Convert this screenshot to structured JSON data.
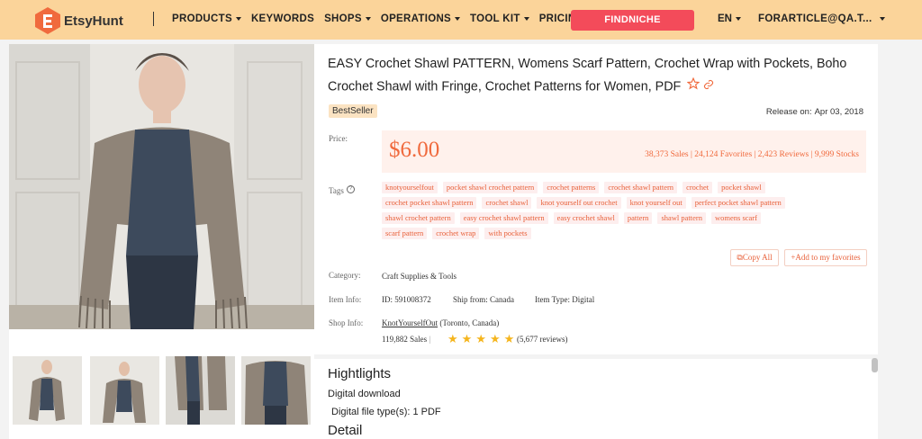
{
  "nav": {
    "brand": "EtsyHunt",
    "menu": [
      "PRODUCTS",
      "KEYWORDS",
      "SHOPS",
      "OPERATIONS",
      "TOOL KIT",
      "PRICING"
    ],
    "cta": "FINDNICHE",
    "language": "EN",
    "account": "FORARTICLE@QA.T..."
  },
  "product": {
    "title": "EASY Crochet Shawl PATTERN, Womens Scarf Pattern, Crochet Wrap with Pockets, Boho Crochet Shawl with Fringe, Crochet Patterns for Women, PDF",
    "badge": "BestSeller",
    "release_label": "Release on:",
    "release_date": "Apr 03, 2018",
    "price_label": "Price:",
    "price": "$6.00",
    "stats": "38,373 Sales | 24,124 Favorites | 2,423 Reviews | 9,999 Stocks",
    "tags_label": "Tags",
    "tags": [
      "knotyourselfout",
      "pocket shawl crochet pattern",
      "crochet patterns",
      "crochet shawl pattern",
      "crochet",
      "pocket shawl",
      "crochet pocket shawl pattern",
      "crochet shawl",
      "knot yourself out crochet",
      "knot yourself out",
      "perfect pocket shawl pattern",
      "shawl crochet pattern",
      "easy crochet shawl pattern",
      "easy crochet shawl",
      "pattern",
      "shawl pattern",
      "womens scarf",
      "scarf pattern",
      "crochet wrap",
      "with pockets"
    ],
    "copy_all": "Copy All",
    "add_favorites": "+Add to my favorites",
    "category_label": "Category:",
    "category": "Craft Supplies & Tools",
    "item_info_label": "Item Info:",
    "item_id": "ID: 591008372",
    "ship_from": "Ship from: Canada",
    "item_type": "Item Type: Digital",
    "shop_info_label": "Shop Info:",
    "shop_name": "KnotYourselfOut",
    "shop_location": "(Toronto, Canada)",
    "shop_sales": "119,882 Sales",
    "shop_rating_stars": 5,
    "shop_reviews": "(5,677 reviews)"
  },
  "highlights": {
    "heading": "Hightlights",
    "line1": "Digital download",
    "line2": "Digital file type(s): 1 PDF",
    "detail_heading": "Detail"
  },
  "colors": {
    "nav_bg": "#fbd49a",
    "accent_red": "#f34b5a",
    "price_orange": "#f06a3d",
    "star_gold": "#f5b51d"
  }
}
